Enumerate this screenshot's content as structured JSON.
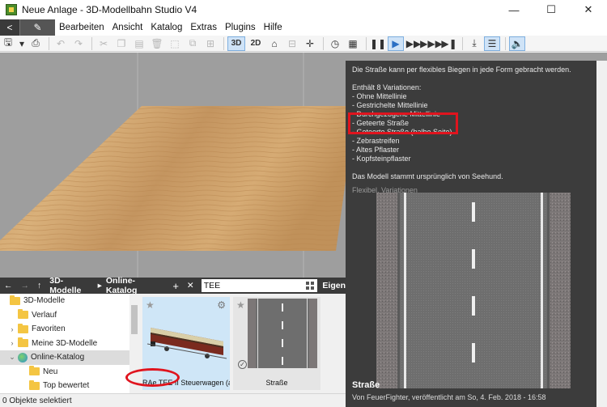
{
  "window": {
    "title": "Neue Anlage - 3D-Modellbahn Studio V4",
    "minimize": "—",
    "maximize": "☐",
    "close": "✕"
  },
  "menu": {
    "back": "<",
    "items": [
      "Bearbeiten",
      "Ansicht",
      "Katalog",
      "Extras",
      "Plugins",
      "Hilfe"
    ]
  },
  "toolbar": {
    "view_3d": "3D",
    "view_2d": "2D"
  },
  "tooltip": {
    "intro": "Die Straße kann per flexibles Biegen in jede Form gebracht werden.",
    "variations_header": "Enthält 8 Variationen:",
    "variations": [
      "- Ohne Mittellinie",
      "- Gestrichelte Mittellinie",
      "- Durchgezogene Mittellinie",
      "- Geteerte Straße",
      "- Geteerte Straße (halbe Seite)",
      "- Zebrastreifen",
      "- Altes Pflaster",
      "- Kopfsteinpflaster"
    ],
    "origin": "Das Modell stammt ursprünglich von Seehund.",
    "tags": "Flexibel, Variationen",
    "model_name": "Straße",
    "model_meta": "Von FeuerFighter, veröffentlicht am So, 4. Feb. 2018 - 16:58"
  },
  "pathbar": {
    "crumb1": "3D-Modelle",
    "crumb2": "Online-Katalog",
    "search_value": "TEE",
    "right_label": "Eigen"
  },
  "tree": {
    "items": [
      {
        "label": "3D-Modelle"
      },
      {
        "label": "Verlauf"
      },
      {
        "label": "Favoriten"
      },
      {
        "label": "Meine 3D-Modelle"
      },
      {
        "label": "Online-Katalog"
      },
      {
        "label": "Neu"
      },
      {
        "label": "Top bewertet"
      }
    ]
  },
  "tiles": {
    "tile1_caption": "RAe TEE II Steuerwagen (aktiv)",
    "tile2_caption": "Straße"
  },
  "status": {
    "text": "0 Objekte selektiert"
  }
}
